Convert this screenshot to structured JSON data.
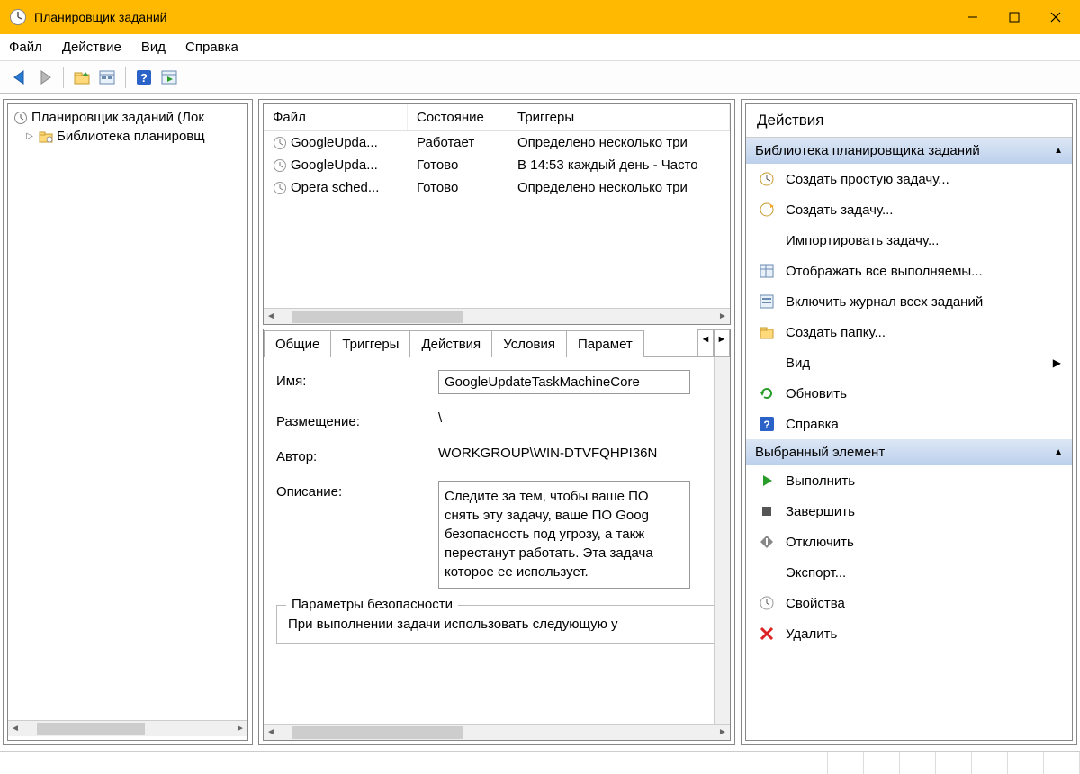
{
  "titlebar": {
    "title": "Планировщик заданий"
  },
  "menubar": {
    "file": "Файл",
    "action": "Действие",
    "view": "Вид",
    "help": "Справка"
  },
  "tree": {
    "root": "Планировщик заданий (Лок",
    "child": "Библиотека планировщ"
  },
  "tasks": {
    "columns": {
      "file": "Файл",
      "state": "Состояние",
      "triggers": "Триггеры"
    },
    "rows": [
      {
        "file": "GoogleUpda...",
        "state": "Работает",
        "trig": "Определено несколько три"
      },
      {
        "file": "GoogleUpda...",
        "state": "Готово",
        "trig": "В 14:53 каждый день - Часто"
      },
      {
        "file": "Opera sched...",
        "state": "Готово",
        "trig": "Определено несколько три"
      }
    ]
  },
  "tabs": {
    "general": "Общие",
    "triggers": "Триггеры",
    "actions": "Действия",
    "conditions": "Условия",
    "params": "Парамет"
  },
  "details": {
    "labels": {
      "name": "Имя:",
      "location": "Размещение:",
      "author": "Автор:",
      "desc": "Описание:"
    },
    "name": "GoogleUpdateTaskMachineCore",
    "location": "\\",
    "author": "WORKGROUP\\WIN-DTVFQHPI36N",
    "desc": "Следите за тем, чтобы ваше ПО снять эту задачу, ваше ПО Goog безопасность под угрозу, а такж перестанут работать. Эта задача которое ее использует.",
    "security_group": "Параметры безопасности",
    "security_line": "При выполнении задачи использовать следующую у"
  },
  "actions_pane": {
    "title": "Действия",
    "section1": "Библиотека планировщика заданий",
    "items1": [
      "Создать простую задачу...",
      "Создать задачу...",
      "Импортировать задачу...",
      "Отображать все выполняемы...",
      "Включить журнал всех заданий",
      "Создать папку...",
      "Вид",
      "Обновить",
      "Справка"
    ],
    "section2": "Выбранный элемент",
    "items2": [
      "Выполнить",
      "Завершить",
      "Отключить",
      "Экспорт...",
      "Свойства",
      "Удалить"
    ]
  }
}
